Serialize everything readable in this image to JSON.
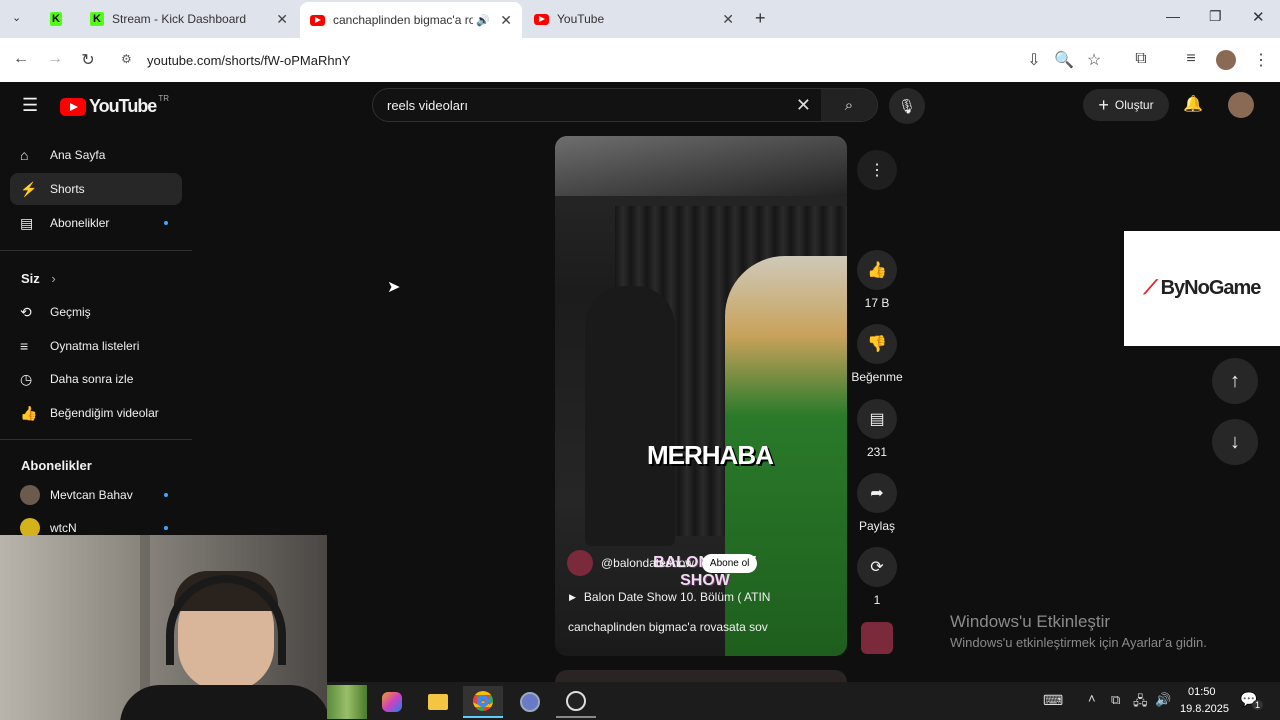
{
  "browser": {
    "tabs": [
      {
        "title": "",
        "favicon": "kick"
      },
      {
        "title": "Stream - Kick Dashboard",
        "favicon": "kick"
      },
      {
        "title": "canchaplinden bigmac'a ro",
        "favicon": "youtube"
      },
      {
        "title": "YouTube",
        "favicon": "youtube"
      }
    ],
    "url": "youtube.com/shorts/fW-oPMaRhnY"
  },
  "youtube": {
    "logo_text": "YouTube",
    "logo_region": "TR",
    "search_value": "reels videoları",
    "create_label": "Oluştur",
    "sidebar": {
      "main_items": [
        {
          "label": "Ana Sayfa",
          "icon": "home-icon"
        },
        {
          "label": "Shorts",
          "icon": "shorts-icon"
        },
        {
          "label": "Abonelikler",
          "icon": "subscriptions-icon"
        }
      ],
      "you_heading": "Siz",
      "you_items": [
        {
          "label": "Geçmiş",
          "icon": "history-icon"
        },
        {
          "label": "Oynatma listeleri",
          "icon": "playlist-icon"
        },
        {
          "label": "Daha sonra izle",
          "icon": "clock-icon"
        },
        {
          "label": "Beğendiğim videolar",
          "icon": "like-icon"
        }
      ],
      "subs_heading": "Abonelikler",
      "subs": [
        {
          "label": "Mevtcan Bahav"
        },
        {
          "label": "wtcN"
        }
      ]
    },
    "short": {
      "overlay_text": "MERHABA",
      "channel": "@balondateshow",
      "subscribe_label": "Abone ol",
      "playlist": "Balon Date Show 10. Bölüm ( ATIN",
      "title": "canchaplinden bigmac'a rovasata sov",
      "show_logo": "BALON DATE SHOW"
    },
    "actions": {
      "likes": "17 B",
      "dislike_label": "Beğenme",
      "comments": "231",
      "share_label": "Paylaş",
      "remix_count": "1"
    },
    "ad_brand": "ByNoGame"
  },
  "windows": {
    "activate_title": "Windows'u Etkinleştir",
    "activate_sub": "Windows'u etkinleştirmek için Ayarlar'a gidin.",
    "time": "01:50",
    "date": "19.8.2025",
    "notifications": "1"
  }
}
